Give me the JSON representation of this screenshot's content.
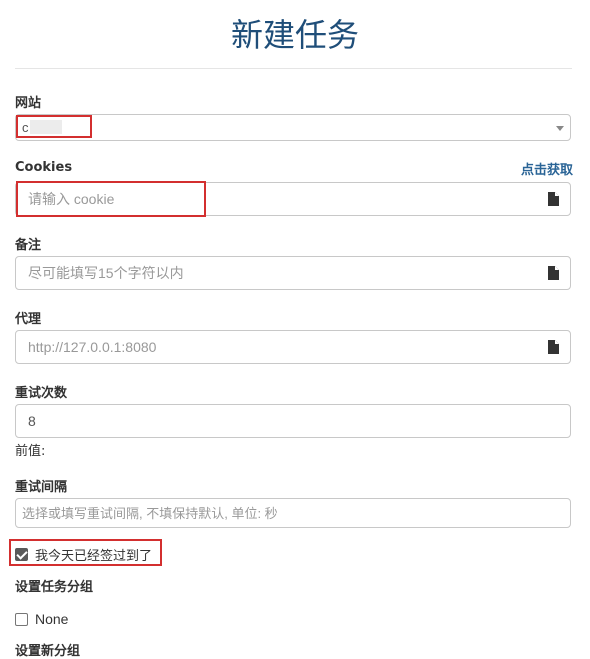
{
  "page": {
    "title": "新建任务"
  },
  "site": {
    "label": "网站",
    "value": "c"
  },
  "cookies": {
    "label": "Cookies",
    "fetch_link": "点击获取",
    "placeholder": "请输入 cookie"
  },
  "remark": {
    "label": "备注",
    "placeholder": "尽可能填写15个字符以内"
  },
  "proxy": {
    "label": "代理",
    "placeholder": "http://127.0.0.1:8080"
  },
  "retry_count": {
    "label": "重试次数",
    "value": "8",
    "helper": "前值:"
  },
  "retry_interval": {
    "label": "重试间隔",
    "placeholder": "选择或填写重试间隔, 不填保持默认, 单位: 秒"
  },
  "signed_today": {
    "label": "我今天已经签过到了",
    "checked": true
  },
  "task_group": {
    "label": "设置任务分组",
    "option_label": "None",
    "checked": false
  },
  "new_group": {
    "label": "设置新分组"
  },
  "icons": {
    "file": "file-icon",
    "caret": "chevron-down-icon"
  },
  "colors": {
    "title": "#1f4e79",
    "link": "#2a6496",
    "highlight": "#d32f2f"
  }
}
